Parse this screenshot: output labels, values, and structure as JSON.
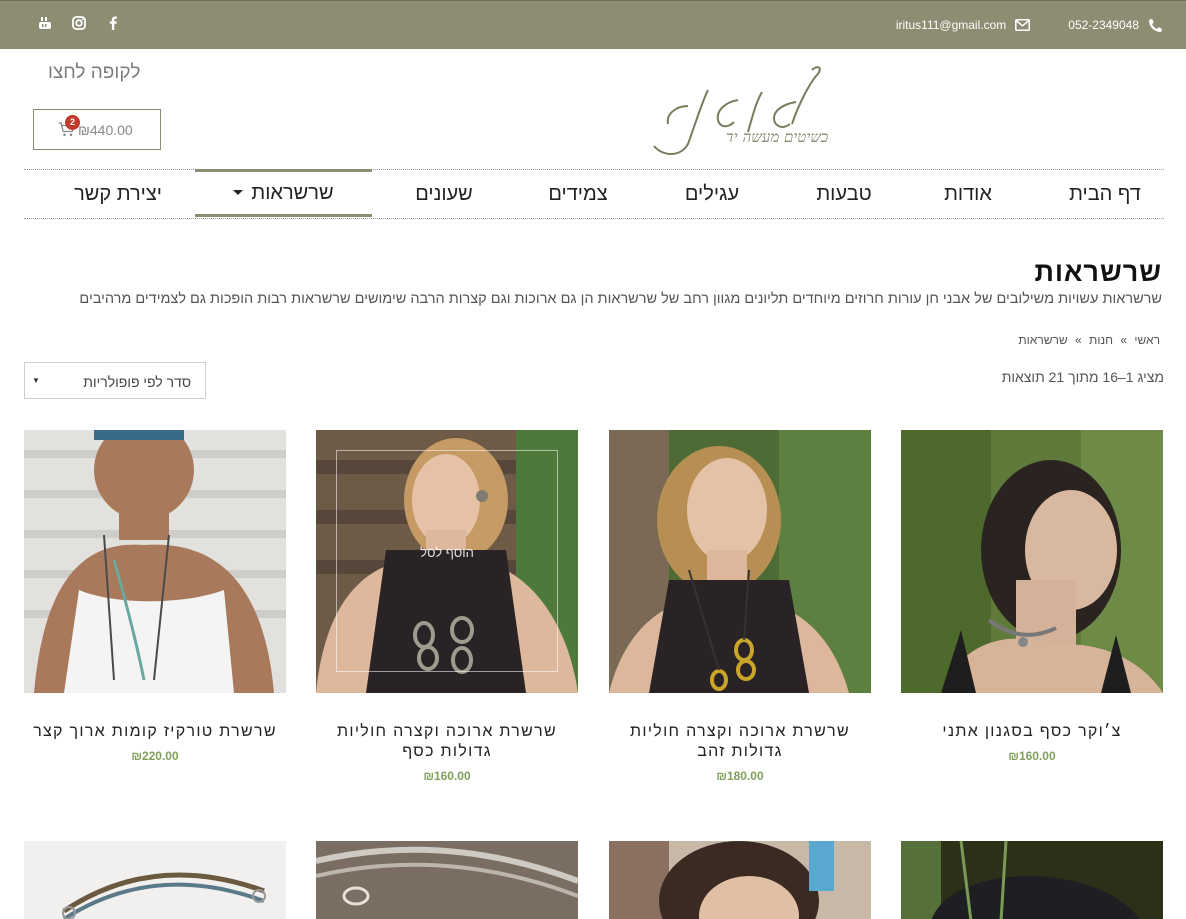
{
  "topbar": {
    "phone": "052-2349048",
    "email": "iritus111@gmail.com",
    "social_icons": [
      "youtube-icon",
      "instagram-icon",
      "facebook-icon"
    ]
  },
  "header": {
    "checkout_label": "לקופה לחצו",
    "cart_count": "2",
    "cart_total": "₪440.00",
    "logo_text": "אירית",
    "logo_tagline": "תכשיטים מעשה יד"
  },
  "nav": {
    "items": [
      {
        "label": "דף הבית"
      },
      {
        "label": "אודות"
      },
      {
        "label": "טבעות"
      },
      {
        "label": "עגילים"
      },
      {
        "label": "צמידים"
      },
      {
        "label": "שעונים"
      },
      {
        "label": "שרשראות"
      },
      {
        "label": "יצירת קשר"
      }
    ]
  },
  "page": {
    "title": "שרשראות",
    "description": "שרשראות עשויות משילובים של אבני חן עורות חרוזים מיוחדים תליונים מגוון רחב של שרשראות הן גם ארוכות וגם קצרות הרבה שימושים שרשראות רבות הופכות גם לצמידים מרהיבים",
    "breadcrumb": [
      "ראשי",
      "»",
      "חנות",
      "»",
      "שרשראות"
    ],
    "result_count": "מציג 1–16 מתוך 21 תוצאות",
    "sort_label": "סדר לפי פופולריות"
  },
  "products": [
    {
      "name": "צ׳וקר כסף בסגנון אתני",
      "price": "₪160.00"
    },
    {
      "name": "שרשרת ארוכה וקצרה חוליות גדולות זהב",
      "price": "₪180.00"
    },
    {
      "name": "שרשרת ארוכה וקצרה חוליות גדולות כסף",
      "price": "₪160.00",
      "hover_label": "הוסף לסל"
    },
    {
      "name": "שרשרת טורקיז קומות ארוך קצר",
      "price": "₪220.00"
    }
  ],
  "colors": {
    "brand": "#8c8d73",
    "price": "#7fa05a",
    "badge": "#c0392b"
  }
}
